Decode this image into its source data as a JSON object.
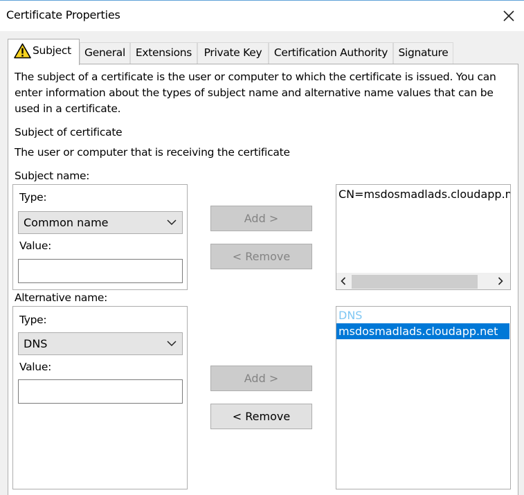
{
  "window": {
    "title": "Certificate Properties"
  },
  "tabs": [
    {
      "label": "Subject"
    },
    {
      "label": "General"
    },
    {
      "label": "Extensions"
    },
    {
      "label": "Private Key"
    },
    {
      "label": "Certification Authority"
    },
    {
      "label": "Signature"
    }
  ],
  "subject_tab": {
    "description": "The subject of a certificate is the user or computer to which the certificate is issued. You can enter information about the types of subject name and alternative name values that can be used in a certificate.",
    "heading": "Subject of certificate",
    "subheading": "The user or computer that is receiving the certificate",
    "subject_name": {
      "group_label": "Subject name:",
      "type_label": "Type:",
      "type_value": "Common name",
      "value_label": "Value:",
      "value_text": "",
      "add_button": "Add >",
      "remove_button": "< Remove",
      "list_items": [
        "CN=msdosmadlads.cloudapp.net"
      ]
    },
    "alternative_name": {
      "group_label": "Alternative name:",
      "type_label": "Type:",
      "type_value": "DNS",
      "value_label": "Value:",
      "value_text": "",
      "add_button": "Add >",
      "remove_button": "< Remove",
      "list_header": "DNS",
      "list_items": [
        "msdosmadlads.cloudapp.net"
      ]
    }
  },
  "colors": {
    "selection": "#0078d7",
    "list_header": "#7fc7f3",
    "warning_fill": "#f7d31f"
  },
  "icons": {
    "close": "close-icon",
    "warning": "warning-icon",
    "chevron": "chevron-down-icon",
    "scroll_left": "scroll-left-arrow-icon",
    "scroll_right": "scroll-right-arrow-icon"
  }
}
